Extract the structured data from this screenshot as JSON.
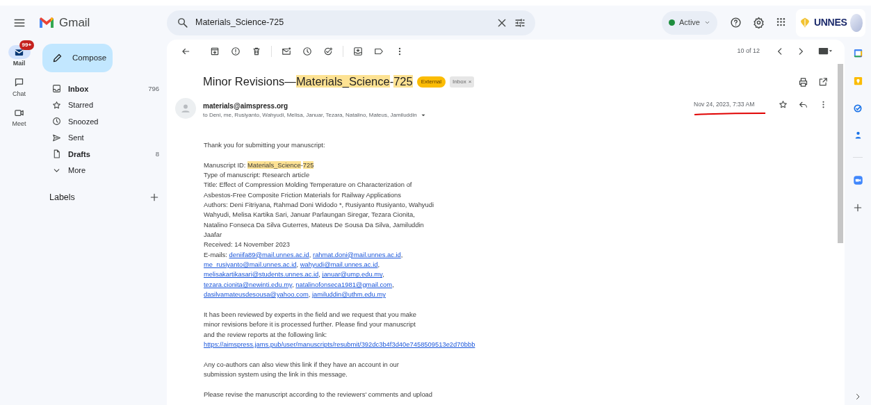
{
  "header": {
    "app_name": "Gmail",
    "search": {
      "value": "Materials_Science-725"
    },
    "status": {
      "label": "Active",
      "color": "#1e8e3e"
    },
    "org_logo": "UNNES"
  },
  "rail": [
    {
      "label": "Mail",
      "badge": "99+",
      "selected": true
    },
    {
      "label": "Chat",
      "selected": false
    },
    {
      "label": "Meet",
      "selected": false
    }
  ],
  "compose": "Compose",
  "folders": [
    {
      "label": "Inbox",
      "count": "796",
      "bold": true
    },
    {
      "label": "Starred",
      "bold": false
    },
    {
      "label": "Snoozed",
      "bold": false
    },
    {
      "label": "Sent",
      "bold": false
    },
    {
      "label": "Drafts",
      "count": "8",
      "bold": true
    },
    {
      "label": "More",
      "bold": false
    }
  ],
  "labels_heading": "Labels",
  "pager": "10 of 12",
  "message": {
    "subject": [
      {
        "text": "Minor Revisions—"
      },
      {
        "text": "Materials_Science",
        "highlight": true
      },
      {
        "text": "-"
      },
      {
        "text": "725",
        "highlight": true
      }
    ],
    "tags": [
      {
        "label": "External",
        "kind": "external"
      },
      {
        "label": "Inbox",
        "kind": "folder",
        "remove": "×"
      }
    ],
    "sender": "materials@aimspress.org",
    "recipients": "to Deni, me, Rusiyanto, Wahyudi, Melisa, Januar, Tezara, Natalino, Mateus, Jamiluddin",
    "date": "Nov 24, 2023, 7:33 AM",
    "date_underlined": true,
    "body": [
      [
        [
          {
            "text": "Thank you for submitting your manuscript:"
          }
        ]
      ],
      [
        [
          {
            "text": "Manuscript ID: "
          },
          {
            "text": "Materials_Science",
            "kind": "highlight"
          },
          {
            "text": "-"
          },
          {
            "text": "725",
            "kind": "highlight"
          }
        ],
        [
          {
            "text": "Type of manuscript: Research article"
          }
        ],
        [
          {
            "text": "Title: Effect of Compression Molding Temperature on Characterization of"
          }
        ],
        [
          {
            "text": "Asbestos-Free Composite Friction Materials for Railway Applications"
          }
        ],
        [
          {
            "text": "Authors: Deni Fitriyana, Rahmad Doni Widodo *, Rusiyanto Rusiyanto, Wahyudi"
          }
        ],
        [
          {
            "text": "Wahyudi, Melisa Kartika Sari, Januar Parlaungan Siregar, Tezara Cionita,"
          }
        ],
        [
          {
            "text": "Natalino Fonseca Da Silva Guterres, Mateus De Sousa Da Silva, Jamiluddin"
          }
        ],
        [
          {
            "text": "Jaafar"
          }
        ],
        [
          {
            "text": "Received: 14 November 2023"
          }
        ],
        [
          {
            "text": "E-mails: "
          },
          {
            "text": "deniifa89@mail.unnes.ac.id",
            "kind": "link"
          },
          {
            "text": ", "
          },
          {
            "text": "rahmat.doni@mail.unnes.ac.id",
            "kind": "link"
          },
          {
            "text": ","
          }
        ],
        [
          {
            "text": "me_rusiyanto@mail.unnes.ac.id",
            "kind": "link"
          },
          {
            "text": ", "
          },
          {
            "text": "wahyudi@mail.unnes.ac.id",
            "kind": "link"
          },
          {
            "text": ","
          }
        ],
        [
          {
            "text": "melisakartikasari@students.unnes.ac.id",
            "kind": "link"
          },
          {
            "text": ", "
          },
          {
            "text": "januar@ump.edu.my",
            "kind": "link"
          },
          {
            "text": ","
          }
        ],
        [
          {
            "text": "tezara.cionita@newinti.edu.my",
            "kind": "link"
          },
          {
            "text": ", "
          },
          {
            "text": "natalinofonseca1981@gmail.com",
            "kind": "link"
          },
          {
            "text": ","
          }
        ],
        [
          {
            "text": "dasilvamateusdesousa@yahoo.com",
            "kind": "link"
          },
          {
            "text": ", "
          },
          {
            "text": "jamiluddin@uthm.edu.my",
            "kind": "link"
          }
        ]
      ],
      [
        [
          {
            "text": "It has been reviewed by experts in the field and we request that you make"
          }
        ],
        [
          {
            "text": "minor revisions before it is processed further. Please find your manuscript"
          }
        ],
        [
          {
            "text": "and the review reports at the following link:"
          }
        ],
        [
          {
            "text": "https://aimspress.jams.pub/user/manuscripts/resubmit/392dc3b4f3d40e7458509513e2d70bbb",
            "kind": "link"
          }
        ]
      ],
      [
        [
          {
            "text": "Any co-authors can also view this link if they have an account in our"
          }
        ],
        [
          {
            "text": "submission system using the link in this message."
          }
        ]
      ],
      [
        [
          {
            "text": "Please revise the manuscript according to the reviewers' comments and upload"
          }
        ]
      ]
    ]
  }
}
